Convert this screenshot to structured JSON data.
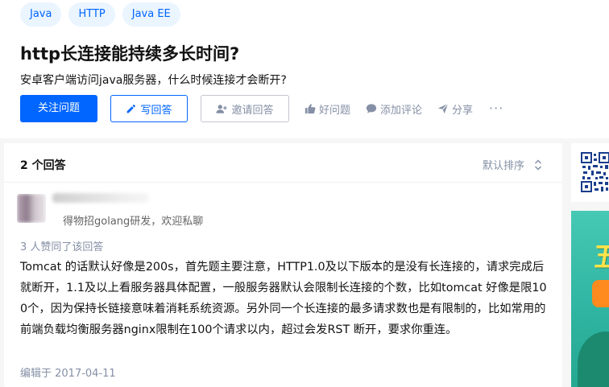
{
  "tags": [
    "Java",
    "HTTP",
    "Java EE"
  ],
  "question": {
    "title": "http长连接能持续多长时间?",
    "detail": "安卓客户端访问java服务器，什么时候连接才会断开?"
  },
  "actions": {
    "follow": "关注问题",
    "write": "写回答",
    "invite": "邀请回答",
    "good": "好问题",
    "comment": "添加评论",
    "share": "分享",
    "more": "···"
  },
  "answers": {
    "count_label": "2 个回答",
    "sort_label": "默认排序",
    "items": [
      {
        "headline": "得物招golang研发，欢迎私聊",
        "votes": "3 人赞同了该回答",
        "body": "Tomcat 的话默认好像是200s，首先题主要注意，HTTP1.0及以下版本的是没有长连接的，请求完成后就断开，1.1及以上看服务器具体配置，一般服务器默认会限制长连接的个数，比如tomcat 好像是限100个，因为保持长链接意味着消耗系统资源。另外同一个长连接的最多请求数也是有限制的，比如常用的前端负载均衡服务器nginx限制在100个请求以内，超过会发RST 断开，要求你重连。",
        "edited": "编辑于 2017-04-11"
      }
    ]
  },
  "sidebar": {
    "banner_text": "五"
  },
  "colors": {
    "brand": "#0066ff",
    "muted": "#8590a6",
    "tag_bg": "#ebf5ff"
  }
}
